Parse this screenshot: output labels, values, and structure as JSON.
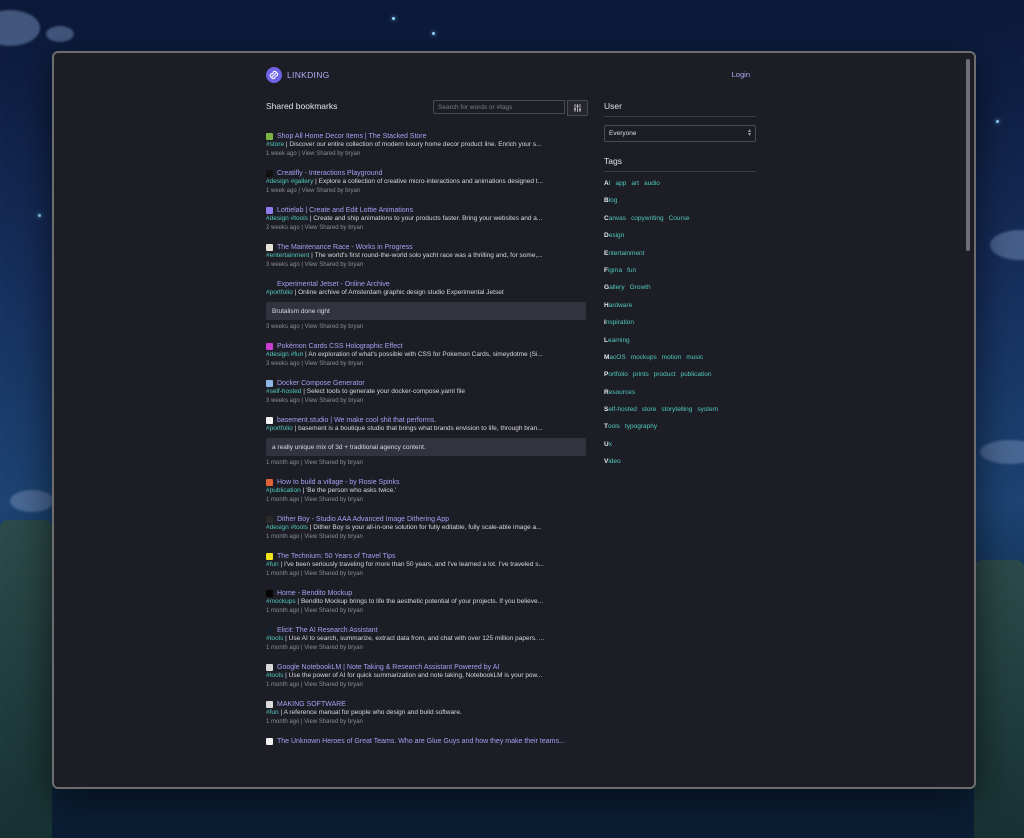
{
  "app": {
    "brand": "LINKDING",
    "login": "Login"
  },
  "main": {
    "title": "Shared bookmarks",
    "search_placeholder": "Search for words or #tags"
  },
  "bookmarks": [
    {
      "title": "Shop All Home Decor Items | The Stacked Store",
      "tags": "#store",
      "desc": "Discover our entire collection of modern luxury home decor product line. Enrich your s...",
      "meta": {
        "age": "1 week ago",
        "view": "View",
        "shared": "Shared by bryan"
      },
      "favicon": "#7cb342"
    },
    {
      "title": "Creatifly - Interactions Playground",
      "tags": "#design #gallery",
      "desc": "Explore a collection of creative micro-interactions and animations designed t...",
      "meta": {
        "age": "1 week ago",
        "view": "View",
        "shared": "Shared by bryan"
      },
      "favicon": "#111111"
    },
    {
      "title": "Lottielab | Create and Edit Lottie Animations",
      "tags": "#design #tools",
      "desc": "Create and ship animations to your products faster. Bring your websites and a...",
      "meta": {
        "age": "2 weeks ago",
        "view": "View",
        "shared": "Shared by bryan"
      },
      "favicon": "#8e7cf0"
    },
    {
      "title": "The Maintenance Race - Works in Progress",
      "tags": "#entertainment",
      "desc": "The world's first round-the-world solo yacht race was a thrilling and, for some,...",
      "meta": {
        "age": "3 weeks ago",
        "view": "View",
        "shared": "Shared by bryan"
      },
      "favicon": "#e7e2d6"
    },
    {
      "title": "Experimental Jetset - Online Archive",
      "tags": "#portfolio",
      "desc": "Online archive of Amsterdam graphic design studio Experimental Jetset",
      "meta": {
        "age": "3 weeks ago",
        "view": "View",
        "shared": "Shared by bryan"
      },
      "favicon": "#1d1d26",
      "note": "Brutalism done right"
    },
    {
      "title": "Pokémon Cards CSS Holographic Effect",
      "tags": "#design #fun",
      "desc": "An exploration of what's possible with CSS for Pokemon Cards, simeydotme (Si...",
      "meta": {
        "age": "3 weeks ago",
        "view": "View",
        "shared": "Shared by bryan"
      },
      "favicon": "#c83fd0"
    },
    {
      "title": "Docker Compose Generator",
      "tags": "#self-hosted",
      "desc": "Select tools to generate your docker-compose.yaml file",
      "meta": {
        "age": "3 weeks ago",
        "view": "View",
        "shared": "Shared by bryan"
      },
      "favicon": "#8fb8e8"
    },
    {
      "title": "basement.studio | We make cool shit that performs.",
      "tags": "#portfolio",
      "desc": "basement is a boutique studio that brings what brands envision to life, through bran...",
      "meta": {
        "age": "1 month ago",
        "view": "View",
        "shared": "Shared by bryan"
      },
      "favicon": "#f2f2f2",
      "note": "a really unique mix of 3d + traditional agency content."
    },
    {
      "title": "How to build a village - by Rosie Spinks",
      "tags": "#publication",
      "desc": "'Be the person who asks twice.'",
      "meta": {
        "age": "1 month ago",
        "view": "View",
        "shared": "Shared by bryan"
      },
      "favicon": "#e0633a"
    },
    {
      "title": "Dither Boy - Studio AAA Advanced Image Dithering App",
      "tags": "#design #tools",
      "desc": "Dither Boy is your all-in-one solution for fully editable, fully scale-able image a...",
      "meta": {
        "age": "1 month ago",
        "view": "View",
        "shared": "Shared by bryan"
      },
      "favicon": "#2a2a2a"
    },
    {
      "title": "The Technium: 50 Years of Travel Tips",
      "tags": "#fun",
      "desc": "I've been seriously traveling for more than 50 years, and I've learned a lot. I've traveled s...",
      "meta": {
        "age": "1 month ago",
        "view": "View",
        "shared": "Shared by bryan"
      },
      "favicon": "#f3e21c"
    },
    {
      "title": "Home - Bendito Mockup",
      "tags": "#mockups",
      "desc": "Bendito Mockup brings to life the aesthetic potential of your projects. If you believe...",
      "meta": {
        "age": "1 month ago",
        "view": "View",
        "shared": "Shared by bryan"
      },
      "favicon": "#050505"
    },
    {
      "title": "Elicit: The AI Research Assistant",
      "tags": "#tools",
      "desc": "Use AI to search, summarize, extract data from, and chat with over 125 million papers. ...",
      "meta": {
        "age": "1 month ago",
        "view": "View",
        "shared": "Shared by bryan"
      },
      "favicon": "#14212e"
    },
    {
      "title": "Google NotebookLM | Note Taking & Research Assistant Powered by AI",
      "tags": "#tools",
      "desc": "Use the power of AI for quick summarization and note taking, NotebookLM is your pow...",
      "meta": {
        "age": "1 month ago",
        "view": "View",
        "shared": "Shared by bryan"
      },
      "favicon": "#d9d9d9"
    },
    {
      "title": "MAKING SOFTWARE",
      "tags": "#fun",
      "desc": "A reference manual for people who design and build software.",
      "meta": {
        "age": "1 month ago",
        "view": "View",
        "shared": "Shared by bryan"
      },
      "favicon": "#dcdcdc"
    },
    {
      "title": "The Unknown Heroes of Great Teams. Who are Glue Guys and how they make their teams...",
      "tags": "",
      "desc": "",
      "meta": {
        "age": "",
        "view": "",
        "shared": ""
      },
      "favicon": "#f0f0f0"
    }
  ],
  "sidebar": {
    "user_title": "User",
    "user_select": "Everyone",
    "tags_title": "Tags",
    "tag_groups": [
      {
        "letter": "A",
        "first_rest": "I",
        "others": [
          "app",
          "art",
          "audio"
        ]
      },
      {
        "letter": "B",
        "first_rest": "log",
        "others": []
      },
      {
        "letter": "C",
        "first_rest": "anvas",
        "others": [
          "copywriting",
          "Course"
        ]
      },
      {
        "letter": "D",
        "first_rest": "esign",
        "others": []
      },
      {
        "letter": "E",
        "first_rest": "ntertainment",
        "others": []
      },
      {
        "letter": "F",
        "first_rest": "igma",
        "others": [
          "fun"
        ]
      },
      {
        "letter": "G",
        "first_rest": "allery",
        "others": [
          "Growth"
        ]
      },
      {
        "letter": "H",
        "first_rest": "ardware",
        "others": []
      },
      {
        "letter": "I",
        "first_rest": "nspiration",
        "others": []
      },
      {
        "letter": "L",
        "first_rest": "earning",
        "others": []
      },
      {
        "letter": "M",
        "first_rest": "acOS",
        "others": [
          "mockups",
          "motion",
          "music"
        ]
      },
      {
        "letter": "P",
        "first_rest": "ortfolio",
        "others": [
          "prints",
          "product",
          "publication"
        ]
      },
      {
        "letter": "R",
        "first_rest": "esources",
        "others": []
      },
      {
        "letter": "S",
        "first_rest": "elf-hosted",
        "others": [
          "store",
          "storytelling",
          "system"
        ]
      },
      {
        "letter": "T",
        "first_rest": "ools",
        "others": [
          "typography"
        ]
      },
      {
        "letter": "U",
        "first_rest": "x",
        "others": []
      },
      {
        "letter": "V",
        "first_rest": "ideo",
        "others": []
      }
    ]
  },
  "colors": {
    "accent": "#a89ff3",
    "tag": "#4fcabb",
    "background": "#1d1d26"
  }
}
